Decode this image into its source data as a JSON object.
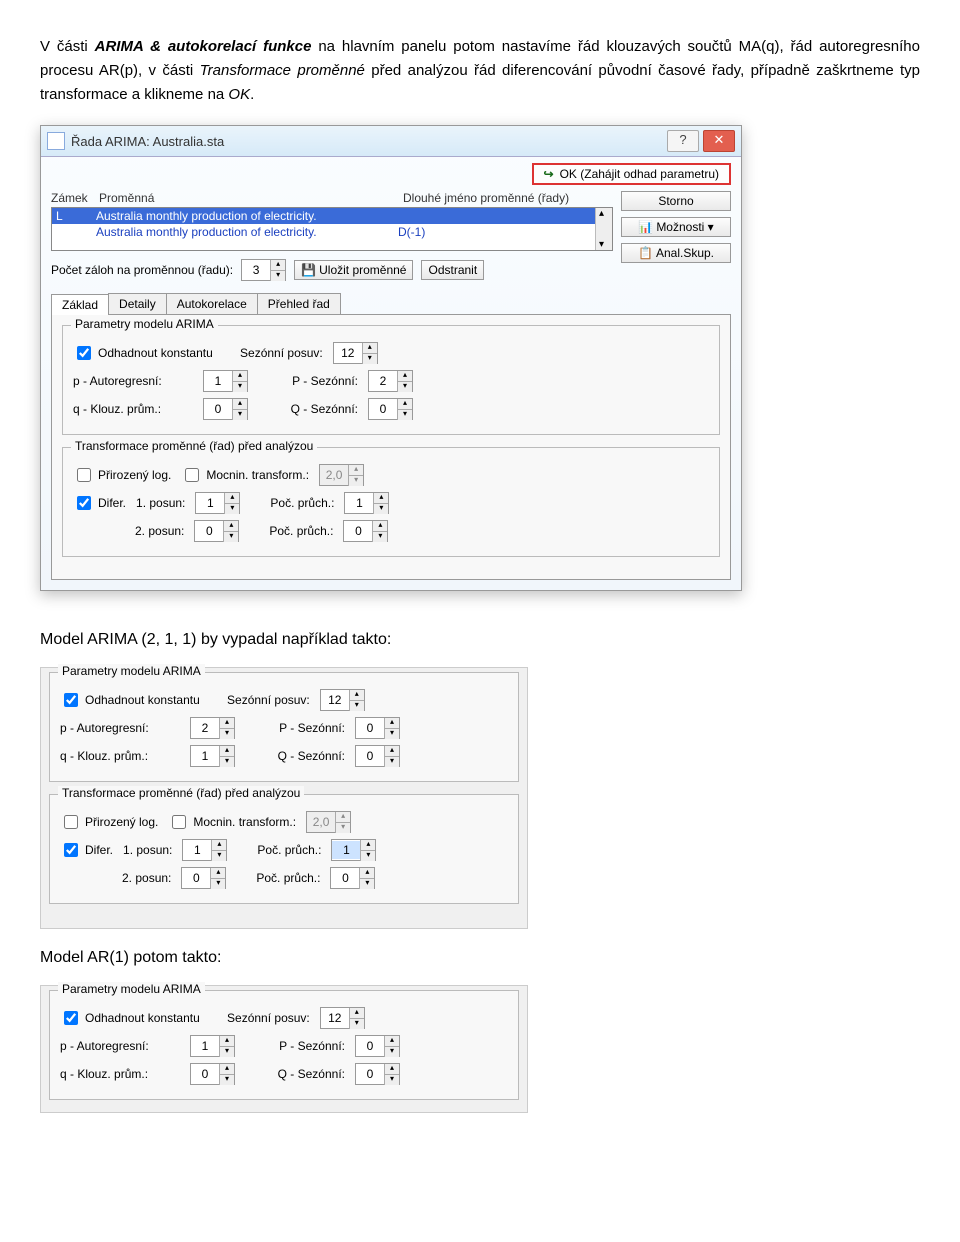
{
  "para1_parts": [
    {
      "t": "V části ",
      "cls": ""
    },
    {
      "t": "ARIMA & autokorelací funkce",
      "cls": "italic bold"
    },
    {
      "t": " na hlavním panelu potom nastavíme řád klouzavých součtů MA(q), řád autoregresního procesu AR(p), v části ",
      "cls": ""
    },
    {
      "t": "Transformace proměnné",
      "cls": "italic"
    },
    {
      "t": " před analýzou řád diferencování původní časové řady, případně zaškrtneme typ transformace a klikneme na ",
      "cls": ""
    },
    {
      "t": "OK",
      "cls": "italic"
    },
    {
      "t": ".",
      "cls": ""
    }
  ],
  "dialog": {
    "title": "Řada ARIMA: Australia.sta",
    "help_glyph": "?",
    "close_glyph": "✕",
    "ok_label": "OK (Zahájit odhad parametru)",
    "headers": {
      "lock": "Zámek",
      "var": "Proměnná",
      "long": "Dlouhé jméno proměnné (řady)"
    },
    "rows": [
      {
        "lock": "L",
        "var": "Australia monthly production of electricity.",
        "long": ""
      },
      {
        "lock": "",
        "var": "Australia monthly production of electricity.",
        "long": "D(-1)"
      }
    ],
    "right_buttons": {
      "storno": "Storno",
      "moznosti": "Možnosti ▾",
      "anal": "Anal.Skup."
    },
    "zalohy_label": "Počet záloh na proměnnou (řadu):",
    "zalohy_value": "3",
    "ulozit": "Uložit proměnné",
    "odstranit": "Odstranit",
    "tabs": [
      "Základ",
      "Detaily",
      "Autokorelace",
      "Přehled řad"
    ],
    "grp1": {
      "title": "Parametry modelu ARIMA",
      "odhadnout": "Odhadnout konstantu",
      "sezonni_posuv": "Sezónní posuv:",
      "sezonni_posuv_v": "12",
      "p_label": "p - Autoregresní:",
      "p_v": "1",
      "P_label": "P - Sezónní:",
      "P_v": "2",
      "q_label": "q - Klouz. prům.:",
      "q_v": "0",
      "Q_label": "Q - Sezónní:",
      "Q_v": "0"
    },
    "grp2": {
      "title": "Transformace proměnné (řad) před analýzou",
      "log": "Přirozený log.",
      "mocnin": "Mocnin. transform.:",
      "mocnin_v": "2,0",
      "difer": "Difer.",
      "posun1": "1. posun:",
      "posun1_v": "1",
      "pruch1": "Poč. průch.:",
      "pruch1_v": "1",
      "posun2": "2. posun:",
      "posun2_v": "0",
      "pruch2": "Poč. průch.:",
      "pruch2_v": "0"
    }
  },
  "line2": "Model ARIMA (2, 1, 1) by vypadal například takto:",
  "panel2": {
    "grp1": {
      "title": "Parametry modelu ARIMA",
      "odhadnout": "Odhadnout konstantu",
      "sezonni_posuv": "Sezónní posuv:",
      "sezonni_posuv_v": "12",
      "p_label": "p - Autoregresní:",
      "p_v": "2",
      "P_label": "P - Sezónní:",
      "P_v": "0",
      "q_label": "q - Klouz. prům.:",
      "q_v": "1",
      "Q_label": "Q - Sezónní:",
      "Q_v": "0"
    },
    "grp2": {
      "title": "Transformace proměnné (řad) před analýzou",
      "log": "Přirozený log.",
      "mocnin": "Mocnin. transform.:",
      "mocnin_v": "2,0",
      "difer": "Difer.",
      "posun1": "1. posun:",
      "posun1_v": "1",
      "pruch1": "Poč. průch.:",
      "pruch1_v": "1",
      "posun2": "2. posun:",
      "posun2_v": "0",
      "pruch2": "Poč. průch.:",
      "pruch2_v": "0"
    }
  },
  "line3": "Model AR(1) potom takto:",
  "panel3": {
    "title": "Parametry modelu ARIMA",
    "odhadnout": "Odhadnout konstantu",
    "sezonni_posuv": "Sezónní posuv:",
    "sezonni_posuv_v": "12",
    "p_label": "p - Autoregresní:",
    "p_v": "1",
    "P_label": "P - Sezónní:",
    "P_v": "0",
    "q_label": "q - Klouz. prům.:",
    "q_v": "0",
    "Q_label": "Q - Sezónní:",
    "Q_v": "0"
  }
}
